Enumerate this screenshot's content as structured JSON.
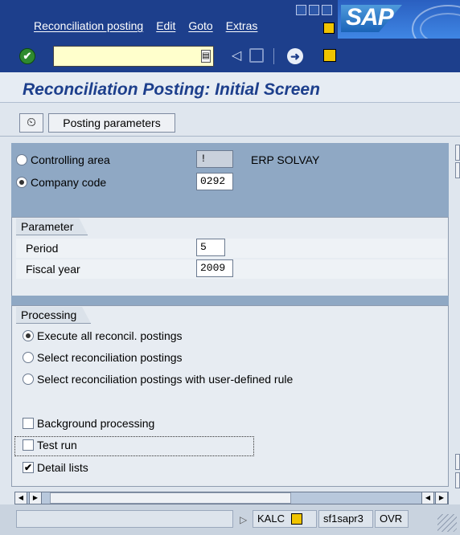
{
  "menu": {
    "items": [
      "Reconciliation posting",
      "Edit",
      "Goto",
      "Extras"
    ],
    "logo_text": "SAP"
  },
  "toolbar": {
    "command_value": "",
    "icons": [
      "ok-icon",
      "command-field-dropdown-icon",
      "nav-back-arrow-icon",
      "save-icon",
      "back-icon",
      "more-functions-icon"
    ]
  },
  "page": {
    "title": "Reconciliation Posting: Initial Screen"
  },
  "app_toolbar": {
    "execute_icon": "execute-icon",
    "posting_parameters_label": "Posting parameters"
  },
  "header": {
    "controlling_area": {
      "label": "Controlling area",
      "value": "!",
      "description": "ERP SOLVAY",
      "selected": false
    },
    "company_code": {
      "label": "Company code",
      "value": "0292",
      "selected": true
    }
  },
  "parameter": {
    "title": "Parameter",
    "period_label": "Period",
    "period_value": "5",
    "fiscal_year_label": "Fiscal year",
    "fiscal_year_value": "2009"
  },
  "processing": {
    "title": "Processing",
    "options": [
      {
        "label": "Execute all reconcil. postings",
        "selected": true
      },
      {
        "label": "Select reconciliation postings",
        "selected": false
      },
      {
        "label": "Select reconciliation postings with user-defined rule",
        "selected": false
      }
    ],
    "checkboxes": [
      {
        "label": "Background processing",
        "checked": false
      },
      {
        "label": "Test run",
        "checked": false
      },
      {
        "label": "Detail lists",
        "checked": true
      }
    ]
  },
  "status": {
    "transaction": "KALC",
    "server": "sf1sapr3",
    "mode": "OVR"
  },
  "colors": {
    "frame": "#1d3f8c",
    "title": "#1d3f8c",
    "header_area": "#8fa8c4"
  }
}
